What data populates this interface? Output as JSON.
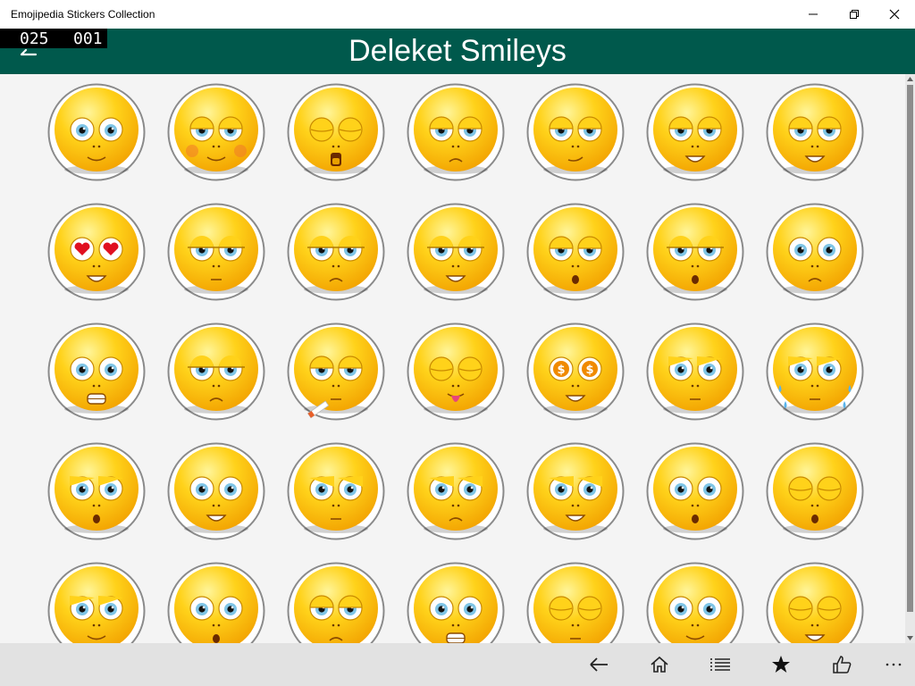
{
  "window": {
    "title": "Emojipedia Stickers Collection"
  },
  "header": {
    "title": "Deleket Smileys",
    "counter_left": "025",
    "counter_right": "001",
    "bg_color": "#00594c"
  },
  "stickers": [
    {
      "eyes": "wide",
      "mouth": "smile",
      "extra": ""
    },
    {
      "eyes": "lidded",
      "mouth": "smile",
      "extra": "blush"
    },
    {
      "eyes": "closed",
      "mouth": "yawn",
      "extra": ""
    },
    {
      "eyes": "lidded",
      "mouth": "frown",
      "extra": ""
    },
    {
      "eyes": "lidded",
      "mouth": "smirk",
      "extra": ""
    },
    {
      "eyes": "lidded",
      "mouth": "grin",
      "extra": ""
    },
    {
      "eyes": "lidded",
      "mouth": "grin",
      "extra": ""
    },
    {
      "eyes": "hearts",
      "mouth": "grin",
      "extra": ""
    },
    {
      "eyes": "flat",
      "mouth": "line",
      "extra": ""
    },
    {
      "eyes": "flat",
      "mouth": "frown",
      "extra": ""
    },
    {
      "eyes": "flat",
      "mouth": "grin",
      "extra": ""
    },
    {
      "eyes": "lidded",
      "mouth": "o",
      "extra": ""
    },
    {
      "eyes": "flat",
      "mouth": "o",
      "extra": ""
    },
    {
      "eyes": "wide",
      "mouth": "frown",
      "extra": ""
    },
    {
      "eyes": "wide",
      "mouth": "teeth",
      "extra": ""
    },
    {
      "eyes": "flat",
      "mouth": "frown",
      "extra": ""
    },
    {
      "eyes": "lidded",
      "mouth": "line",
      "extra": "cigarette"
    },
    {
      "eyes": "closed",
      "mouth": "tongue",
      "extra": ""
    },
    {
      "eyes": "dollar",
      "mouth": "grin",
      "extra": ""
    },
    {
      "eyes": "sad",
      "mouth": "line",
      "extra": ""
    },
    {
      "eyes": "sad",
      "mouth": "line",
      "extra": "tears"
    },
    {
      "eyes": "sad",
      "mouth": "o",
      "extra": ""
    },
    {
      "eyes": "wide",
      "mouth": "grin",
      "extra": ""
    },
    {
      "eyes": "angry",
      "mouth": "line",
      "extra": ""
    },
    {
      "eyes": "angry",
      "mouth": "frown",
      "extra": ""
    },
    {
      "eyes": "angry",
      "mouth": "grin",
      "extra": ""
    },
    {
      "eyes": "wide",
      "mouth": "o",
      "extra": ""
    },
    {
      "eyes": "closed",
      "mouth": "o",
      "extra": ""
    },
    {
      "eyes": "sad",
      "mouth": "smile",
      "extra": ""
    },
    {
      "eyes": "wide",
      "mouth": "o",
      "extra": ""
    },
    {
      "eyes": "lidded",
      "mouth": "frown",
      "extra": ""
    },
    {
      "eyes": "wide",
      "mouth": "teeth",
      "extra": ""
    },
    {
      "eyes": "closed",
      "mouth": "line",
      "extra": ""
    },
    {
      "eyes": "wide",
      "mouth": "smile",
      "extra": ""
    },
    {
      "eyes": "closed",
      "mouth": "grin",
      "extra": ""
    }
  ],
  "appbar": {
    "buttons": [
      {
        "name": "back-arrow-icon"
      },
      {
        "name": "home-icon"
      },
      {
        "name": "list-icon"
      },
      {
        "name": "star-icon"
      },
      {
        "name": "thumbs-up-icon"
      },
      {
        "name": "more-icon"
      }
    ]
  },
  "colors": {
    "face_yellow": "#ffd21a",
    "face_orange": "#f2a100",
    "ring": "#8a8a8a"
  }
}
